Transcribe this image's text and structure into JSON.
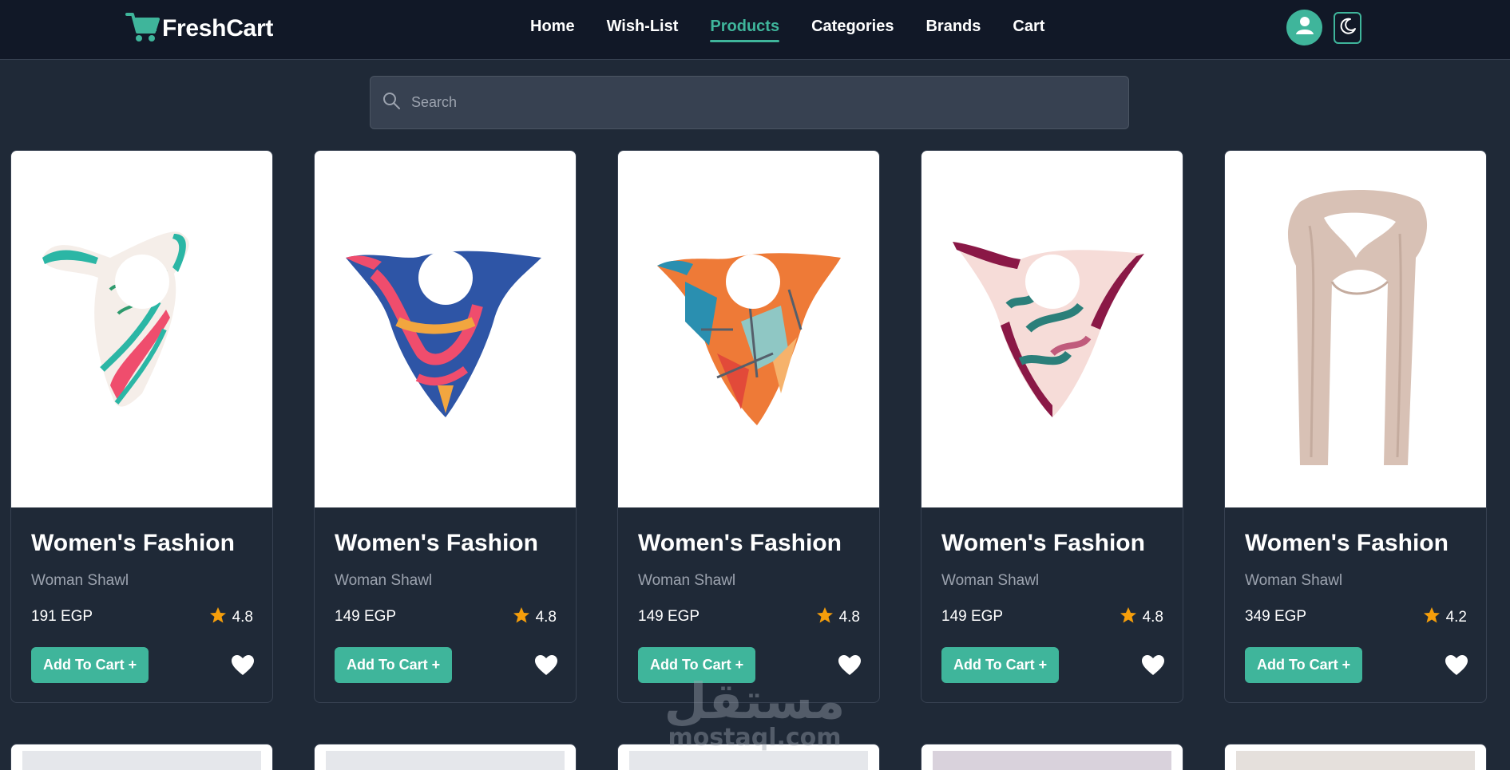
{
  "brand": {
    "name": "FreshCart",
    "icon": "cart-icon"
  },
  "nav": {
    "items": [
      {
        "label": "Home",
        "active": false
      },
      {
        "label": "Wish-List",
        "active": false
      },
      {
        "label": "Products",
        "active": true
      },
      {
        "label": "Categories",
        "active": false
      },
      {
        "label": "Brands",
        "active": false
      },
      {
        "label": "Cart",
        "active": false
      }
    ],
    "user_icon": "user-avatar-icon",
    "theme_icon": "moon-icon"
  },
  "search": {
    "placeholder": "Search",
    "value": ""
  },
  "colors": {
    "accent": "#3fb59b",
    "bg": "#1f2937",
    "nav_bg": "#111827",
    "star": "#f59e0b"
  },
  "products": [
    {
      "category": "Women's Fashion",
      "name": "Woman Shawl",
      "price": "191 EGP",
      "rating": "4.8",
      "add_label": "Add To Cart +",
      "image": "scarf-white-teal-floral"
    },
    {
      "category": "Women's Fashion",
      "name": "Woman Shawl",
      "price": "149 EGP",
      "rating": "4.8",
      "add_label": "Add To Cart +",
      "image": "scarf-navy-pink-floral"
    },
    {
      "category": "Women's Fashion",
      "name": "Woman Shawl",
      "price": "149 EGP",
      "rating": "4.8",
      "add_label": "Add To Cart +",
      "image": "scarf-orange-teal-geometric"
    },
    {
      "category": "Women's Fashion",
      "name": "Woman Shawl",
      "price": "149 EGP",
      "rating": "4.8",
      "add_label": "Add To Cart +",
      "image": "scarf-burgundy-leaf"
    },
    {
      "category": "Women's Fashion",
      "name": "Woman Shawl",
      "price": "349 EGP",
      "rating": "4.2",
      "add_label": "Add To Cart +",
      "image": "shawl-beige-long"
    }
  ],
  "watermark": {
    "arabic": "مستقل",
    "latin": "mostaql.com"
  }
}
